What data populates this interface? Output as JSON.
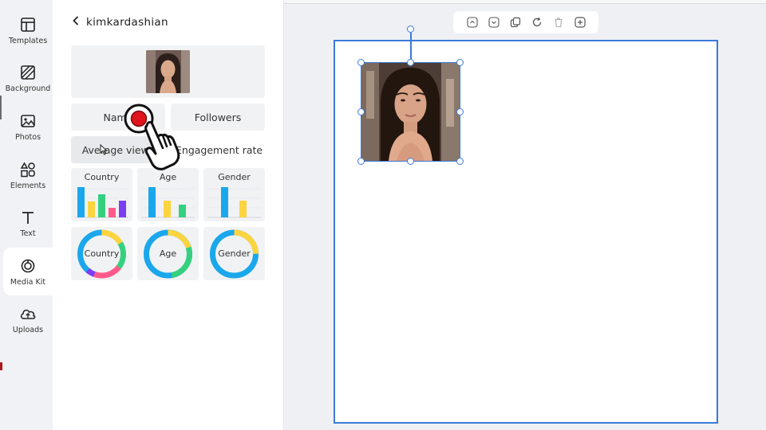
{
  "rail": {
    "items": [
      {
        "label": "Templates",
        "icon": "templates-icon"
      },
      {
        "label": "Background",
        "icon": "background-icon"
      },
      {
        "label": "Photos",
        "icon": "photos-icon"
      },
      {
        "label": "Elements",
        "icon": "elements-icon"
      },
      {
        "label": "Text",
        "icon": "text-icon"
      },
      {
        "label": "Media Kit",
        "icon": "media-kit-icon"
      },
      {
        "label": "Uploads",
        "icon": "uploads-icon"
      }
    ],
    "active": "Media Kit"
  },
  "panel": {
    "back_icon": "chevron-left-icon",
    "title": "kimkardashian",
    "buttons": {
      "name": "Name",
      "followers": "Followers",
      "average_views": "Average views",
      "engagement_rate": "Engagement rate"
    },
    "bar_widgets": {
      "country": "Country",
      "age": "Age",
      "gender": "Gender"
    },
    "donut_widgets": {
      "country": "Country",
      "age": "Age",
      "gender": "Gender"
    }
  },
  "toolbar": {
    "icons": [
      "move-up-icon",
      "move-down-icon",
      "duplicate-icon",
      "rotate-icon",
      "delete-icon",
      "add-icon"
    ]
  },
  "colors": {
    "accent": "#3c7ad8",
    "blue": "#1aa7ec",
    "yellow": "#fcd43f",
    "green": "#35d07f",
    "pink": "#ff5a8a",
    "purple": "#7b3ff2",
    "cursor_red": "#e0141c"
  }
}
